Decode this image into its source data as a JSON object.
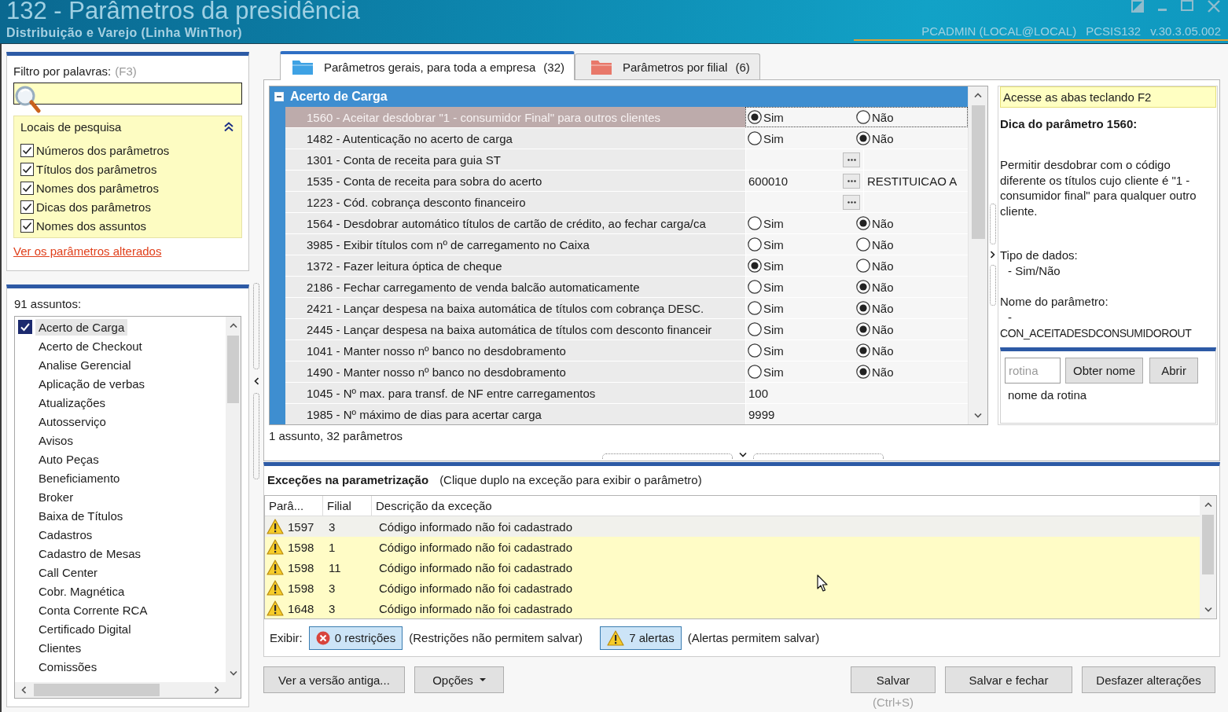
{
  "window": {
    "title": "132 - Parâmetros da presidência",
    "subtitle": "Distribuição e Varejo (Linha WinThor)",
    "user": "PCADMIN (LOCAL@LOCAL)",
    "routine": "PCSIS132",
    "version": "v.30.3.05.002"
  },
  "filter": {
    "label": "Filtro por palavras:",
    "shortcut": "(F3)"
  },
  "search_locations": {
    "title": "Locais de pesquisa",
    "expanded": true,
    "options": [
      {
        "label": "Números dos parâmetros",
        "checked": true
      },
      {
        "label": "Títulos dos parâmetros",
        "checked": true
      },
      {
        "label": "Nomes dos parâmetros",
        "checked": true
      },
      {
        "label": "Dicas dos parâmetros",
        "checked": true
      },
      {
        "label": "Nomes dos assuntos",
        "checked": true
      }
    ]
  },
  "changed_link": "Ver os parâmetros alterados",
  "subjects": {
    "count_label": "91 assuntos:",
    "items": [
      {
        "label": "Acerto de Carga",
        "checked": true,
        "selected": true
      },
      {
        "label": "Acerto de Checkout",
        "checked": false,
        "selected": false
      },
      {
        "label": "Analise Gerencial",
        "checked": false,
        "selected": false
      },
      {
        "label": "Aplicação de verbas",
        "checked": false,
        "selected": false
      },
      {
        "label": "Atualizações",
        "checked": false,
        "selected": false
      },
      {
        "label": "Autosserviço",
        "checked": false,
        "selected": false
      },
      {
        "label": "Avisos",
        "checked": false,
        "selected": false
      },
      {
        "label": "Auto Peças",
        "checked": false,
        "selected": false
      },
      {
        "label": "Beneficiamento",
        "checked": false,
        "selected": false
      },
      {
        "label": "Broker",
        "checked": false,
        "selected": false
      },
      {
        "label": "Baixa de Títulos",
        "checked": false,
        "selected": false
      },
      {
        "label": "Cadastros",
        "checked": false,
        "selected": false
      },
      {
        "label": "Cadastro de Mesas",
        "checked": false,
        "selected": false
      },
      {
        "label": "Call Center",
        "checked": false,
        "selected": false
      },
      {
        "label": "Cobr. Magnética",
        "checked": false,
        "selected": false
      },
      {
        "label": "Conta Corrente RCA",
        "checked": false,
        "selected": false
      },
      {
        "label": "Certificado Digital",
        "checked": false,
        "selected": false
      },
      {
        "label": "Clientes",
        "checked": false,
        "selected": false
      },
      {
        "label": "Comissões",
        "checked": false,
        "selected": false
      }
    ]
  },
  "tabs": [
    {
      "label": "Parâmetros gerais, para toda a empresa",
      "count": "(32)",
      "color": "#3ea2e4",
      "selected": true
    },
    {
      "label": "Parâmetros por filial",
      "count": "(6)",
      "color": "#e8786a",
      "selected": false
    }
  ],
  "parameters": {
    "group": {
      "title": "Acerto de Carga",
      "expanded": true
    },
    "rows": [
      {
        "label": "1560 - Aceitar desdobrar \"1 - consumidor Final\" para outros clientes",
        "kind": "yesno",
        "selected": true,
        "options": [
          {
            "label": "Sim",
            "selected": true
          },
          {
            "label": "Não",
            "selected": false
          }
        ]
      },
      {
        "label": "1482 - Autenticação no acerto de carga",
        "kind": "yesno",
        "selected": false,
        "options": [
          {
            "label": "Sim",
            "selected": false
          },
          {
            "label": "Não",
            "selected": true
          }
        ]
      },
      {
        "label": "1301 - Conta de receita para guia ST",
        "kind": "lookup",
        "selected": false
      },
      {
        "label": "1535 - Conta de receita para sobra do acerto",
        "kind": "lookup",
        "value": "600010",
        "description": "RESTITUICAO A",
        "selected": false
      },
      {
        "label": "1223 - Cód. cobrança desconto financeiro",
        "kind": "lookup",
        "selected": false
      },
      {
        "label": "1564 - Desdobrar automático títulos de cartão de crédito, ao fechar carga/ca",
        "kind": "yesno",
        "selected": false,
        "options": [
          {
            "label": "Sim",
            "selected": false
          },
          {
            "label": "Não",
            "selected": true
          }
        ]
      },
      {
        "label": "3985 - Exibir títulos com nº de carregamento no Caixa",
        "kind": "yesno",
        "selected": false,
        "options": [
          {
            "label": "Sim",
            "selected": false
          },
          {
            "label": "Não",
            "selected": false
          }
        ]
      },
      {
        "label": "1372 - Fazer leitura óptica de cheque",
        "kind": "yesno",
        "selected": false,
        "options": [
          {
            "label": "Sim",
            "selected": true
          },
          {
            "label": "Não",
            "selected": false
          }
        ]
      },
      {
        "label": "2186 - Fechar carregamento de venda balcão automaticamente",
        "kind": "yesno",
        "selected": false,
        "options": [
          {
            "label": "Sim",
            "selected": false
          },
          {
            "label": "Não",
            "selected": true
          }
        ]
      },
      {
        "label": "2421 - Lançar despesa na baixa automática de títulos com cobrança DESC.",
        "kind": "yesno",
        "selected": false,
        "options": [
          {
            "label": "Sim",
            "selected": false
          },
          {
            "label": "Não",
            "selected": true
          }
        ]
      },
      {
        "label": "2445 - Lançar despesa na baixa automática de títulos com desconto financeir",
        "kind": "yesno",
        "selected": false,
        "options": [
          {
            "label": "Sim",
            "selected": false
          },
          {
            "label": "Não",
            "selected": true
          }
        ]
      },
      {
        "label": "1041 - Manter nosso nº banco no desdobramento",
        "kind": "yesno",
        "selected": false,
        "options": [
          {
            "label": "Sim",
            "selected": false
          },
          {
            "label": "Não",
            "selected": true
          }
        ]
      },
      {
        "label": "1490 - Manter nosso nº banco no desdobramento",
        "kind": "yesno",
        "selected": false,
        "options": [
          {
            "label": "Sim",
            "selected": false
          },
          {
            "label": "Não",
            "selected": true
          }
        ]
      },
      {
        "label": "1045 - Nº max. para transf. de NF entre carregamentos",
        "kind": "text",
        "value": "100",
        "selected": false
      },
      {
        "label": "1985 - Nº máximo de dias para acertar carga",
        "kind": "text",
        "value": "9999",
        "selected": false
      }
    ],
    "summary": "1 assunto, 32 parâmetros"
  },
  "hint_panel": {
    "notice": "Acesse as abas teclando F2",
    "title": "Dica do parâmetro 1560:",
    "description": "Permitir desdobrar com o código diferente os títulos cujo cliente é \"1 - consumidor final\" para qualquer outro cliente.",
    "data_type_label": "Tipo de dados:",
    "data_type": "- Sim/Não",
    "name_label": "Nome do parâmetro:",
    "name_dash": "-",
    "name": "CON_ACEITADESDCONSUMIDOROUT"
  },
  "routine_lookup": {
    "placeholder": "rotina",
    "buttons": [
      {
        "label": "Obter nome"
      },
      {
        "label": "Abrir"
      }
    ],
    "result": "nome da rotina"
  },
  "exceptions": {
    "title": "Exceções na parametrização",
    "hint": "(Clique duplo na exceção para exibir o parâmetro)",
    "columns": [
      "Parâ...",
      "Filial",
      "Descrição da exceção"
    ],
    "rows": [
      {
        "kind": "alert",
        "param": "1597",
        "branch": "3",
        "description": "Código informado não foi cadastrado",
        "selected": true
      },
      {
        "kind": "alert",
        "param": "1598",
        "branch": "1",
        "description": "Código informado não foi cadastrado",
        "selected": false
      },
      {
        "kind": "alert",
        "param": "1598",
        "branch": "11",
        "description": "Código informado não foi cadastrado",
        "selected": false
      },
      {
        "kind": "alert",
        "param": "1598",
        "branch": "3",
        "description": "Código informado não foi cadastrado",
        "selected": false
      },
      {
        "kind": "alert",
        "param": "1648",
        "branch": "3",
        "description": "Código informado não foi cadastrado",
        "selected": false
      }
    ],
    "filter_label": "Exibir:",
    "filters": [
      {
        "kind": "restriction",
        "label": "0 restrições",
        "note": "(Restrições não permitem salvar)",
        "on": true
      },
      {
        "kind": "alert",
        "label": "7 alertas",
        "note": "(Alertas permitem salvar)",
        "on": true
      }
    ]
  },
  "actions": {
    "left": [
      {
        "label": "Ver a versão antiga...",
        "kind": "plain"
      },
      {
        "label": "Opções",
        "kind": "menu"
      }
    ],
    "right": [
      {
        "label": "Salvar",
        "shortcut": "(Ctrl+S)"
      },
      {
        "label": "Salvar e fechar"
      },
      {
        "label": "Desfazer alterações"
      }
    ]
  }
}
